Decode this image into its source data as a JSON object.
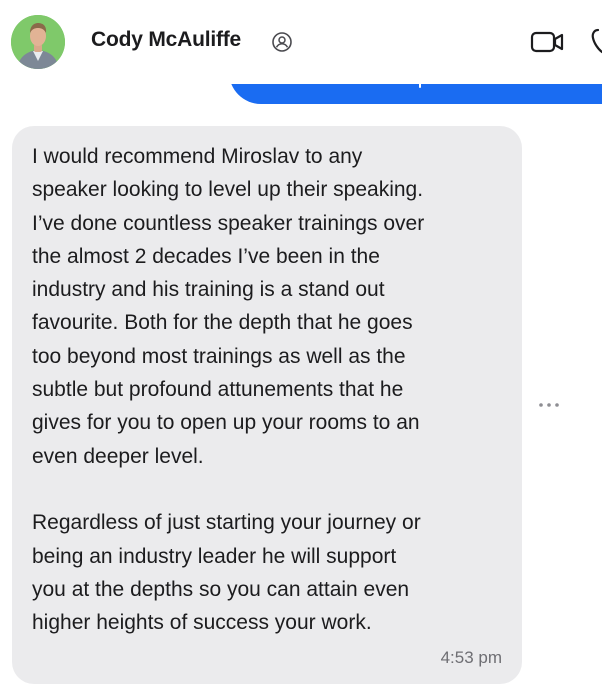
{
  "header": {
    "contact_name": "Cody McAuliffe",
    "verified_icon": "badge-icon",
    "video_icon": "video-camera-icon",
    "extra_icon": "phone-icon"
  },
  "previous_message": {
    "color": "#1a6cf2"
  },
  "message": {
    "paragraph_1": "I would recommend Miroslav to any\nspeaker looking to level up their speaking.\nI’ve done countless speaker trainings over\nthe almost 2 decades I’ve been in the\nindustry and his training is a stand out\nfavourite. Both for the depth that he goes\ntoo beyond most trainings as well as the\nsubtle but profound attunements that he\ngives for you to open up your rooms to an\neven deeper level.",
    "paragraph_2": "Regardless of just starting your journey or\nbeing an industry leader he will support\nyou at the depths so you can attain even\nhigher heights of success your work.",
    "timestamp": "4:53 pm",
    "bubble_color": "#ebebed"
  },
  "actions": {
    "more_icon": "more-horizontal-icon"
  }
}
